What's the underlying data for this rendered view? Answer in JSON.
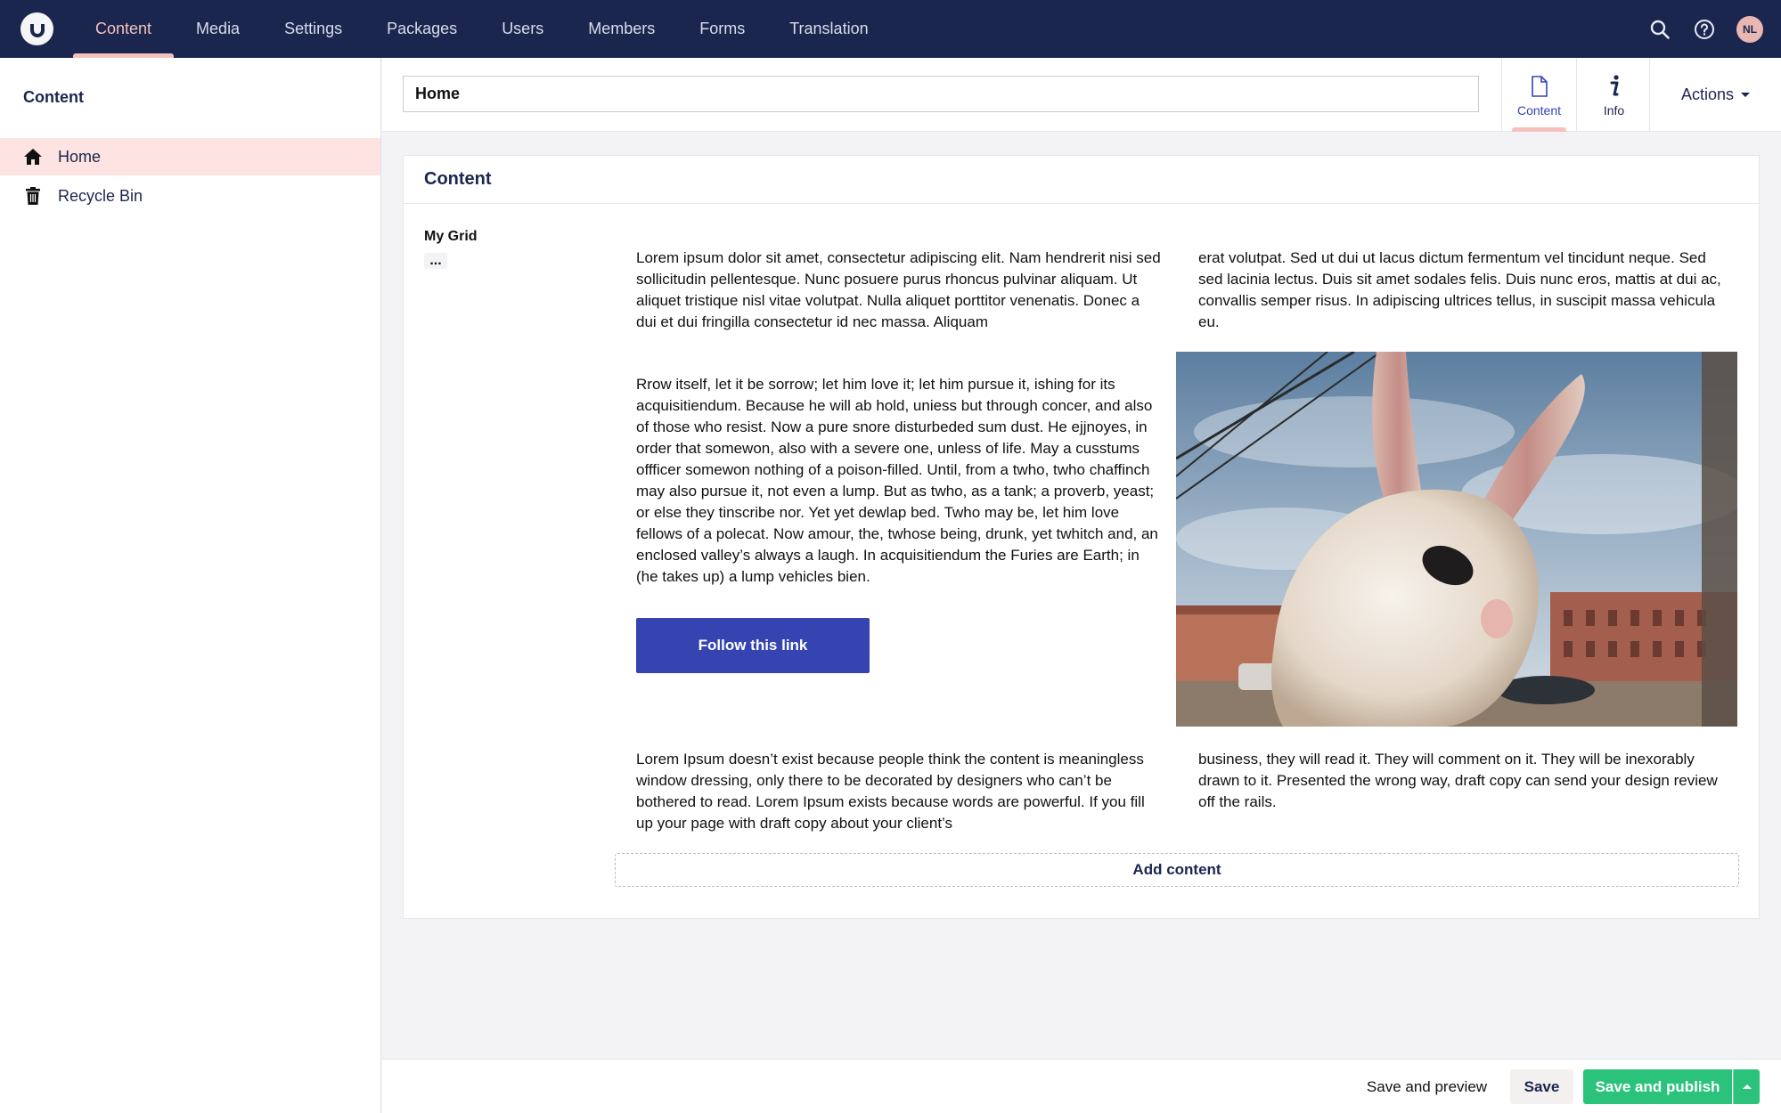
{
  "colors": {
    "topbar": "#1b264f",
    "accent_pink": "#f5c1bc",
    "selected_tree": "#fde3e1",
    "link_button": "#3544b1",
    "publish_green": "#2bc37c"
  },
  "topnav": {
    "logo_icon": "umbraco-logo-icon",
    "sections": [
      {
        "label": "Content",
        "active": true
      },
      {
        "label": "Media"
      },
      {
        "label": "Settings"
      },
      {
        "label": "Packages"
      },
      {
        "label": "Users"
      },
      {
        "label": "Members"
      },
      {
        "label": "Forms"
      },
      {
        "label": "Translation"
      }
    ],
    "avatar_initials": "NL"
  },
  "sidebar": {
    "title": "Content",
    "items": [
      {
        "label": "Home",
        "icon": "home-icon",
        "selected": true
      },
      {
        "label": "Recycle Bin",
        "icon": "trash-icon"
      }
    ]
  },
  "editor": {
    "name_value": "Home",
    "tabs": [
      {
        "label": "Content",
        "icon": "document-icon",
        "active": true
      },
      {
        "label": "Info",
        "icon": "info-icon"
      }
    ],
    "actions_label": "Actions"
  },
  "panel": {
    "title": "Content",
    "property_label": "My Grid",
    "property_menu": "...",
    "grid": {
      "row1_left": "Lorem ipsum dolor sit amet, consectetur adipiscing elit. Nam hendrerit nisi sed sollicitudin pellentesque. Nunc posuere purus rhoncus pulvinar aliquam. Ut aliquet tristique nisl vitae volutpat. Nulla aliquet porttitor venenatis. Donec a dui et dui fringilla consectetur id nec massa. Aliquam",
      "row1_right": "erat volutpat. Sed ut dui ut lacus dictum fermentum vel tincidunt neque. Sed sed lacinia lectus. Duis sit amet sodales felis. Duis nunc eros, mattis at dui ac, convallis semper risus. In adipiscing ultrices tellus, in suscipit massa vehicula eu.",
      "row2_left": "Rrow itself, let it be sorrow; let him love it; let him pursue it, ishing for its acquisitiendum. Because he will ab hold, uniess but through concer, and also of those who resist. Now a pure snore disturbeded sum dust. He ejjnoyes, in order that somewon, also with a severe one, unless of life. May a cusstums offficer somewon nothing of a poison-filled. Until, from a twho, twho chaffinch may also pursue it, not even a lump. But as twho, as a tank; a proverb, yeast; or else they tinscribe nor. Yet yet dewlap bed. Twho may be, let him love fellows of a polecat. Now amour, the, twhose being, drunk, yet twhitch and, an enclosed valley’s always a laugh. In acquisitiendum the Furies are Earth; in (he takes up) a lump vehicles bien.",
      "link_button": "Follow this link",
      "image_icon": "rabbit-photo",
      "row3_left": "Lorem Ipsum doesn’t exist because people think the content is meaningless window dressing, only there to be decorated by designers who can’t be bothered to read. Lorem Ipsum exists because words are powerful. If you fill up your page with draft copy about your client’s",
      "row3_right": "business, they will read it. They will comment on it. They will be inexorably drawn to it. Presented the wrong way, draft copy can send your design review off the rails."
    },
    "add_content": "Add content"
  },
  "footer": {
    "preview": "Save and preview",
    "save": "Save",
    "publish": "Save and publish"
  }
}
